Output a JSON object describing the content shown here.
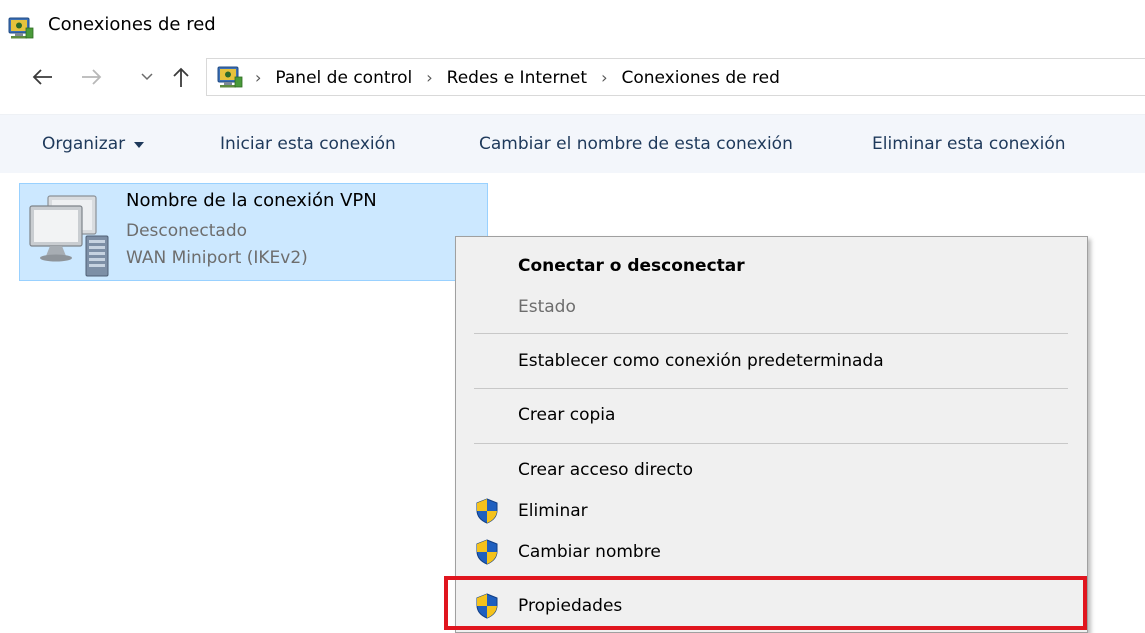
{
  "window": {
    "title": "Conexiones de red",
    "app_icon": "network-connections-icon"
  },
  "navigation": {
    "back_icon": "arrow-left-icon",
    "forward_icon": "arrow-right-icon",
    "recent_icon": "chevron-down-icon",
    "up_icon": "arrow-up-icon",
    "address_icon": "control-panel-icon",
    "breadcrumbs": [
      "Panel de control",
      "Redes e Internet",
      "Conexiones de red"
    ]
  },
  "toolbar": {
    "organize_label": "Organizar",
    "start_label": "Iniciar esta conexión",
    "rename_label": "Cambiar el nombre de esta conexión",
    "delete_label": "Eliminar esta conexión"
  },
  "connection": {
    "name": "Nombre de la conexión VPN",
    "status": "Desconectado",
    "device": "WAN Miniport (IKEv2)",
    "icon": "vpn-connection-icon"
  },
  "context_menu": {
    "items": [
      {
        "label": "Conectar o desconectar",
        "bold": true
      },
      {
        "label": "Estado",
        "disabled": true
      },
      {
        "label": "Establecer como conexión predeterminada"
      },
      {
        "label": "Crear copia"
      },
      {
        "label": "Crear acceso directo"
      },
      {
        "label": "Eliminar",
        "icon": "uac-shield-icon"
      },
      {
        "label": "Cambiar nombre",
        "icon": "uac-shield-icon"
      },
      {
        "label": "Propiedades",
        "icon": "uac-shield-icon",
        "highlighted": true
      }
    ]
  },
  "colors": {
    "selection_fill": "#cce8ff",
    "selection_border": "#99d1ff",
    "command_text": "#1e395b",
    "highlight_border": "#e0151e"
  }
}
